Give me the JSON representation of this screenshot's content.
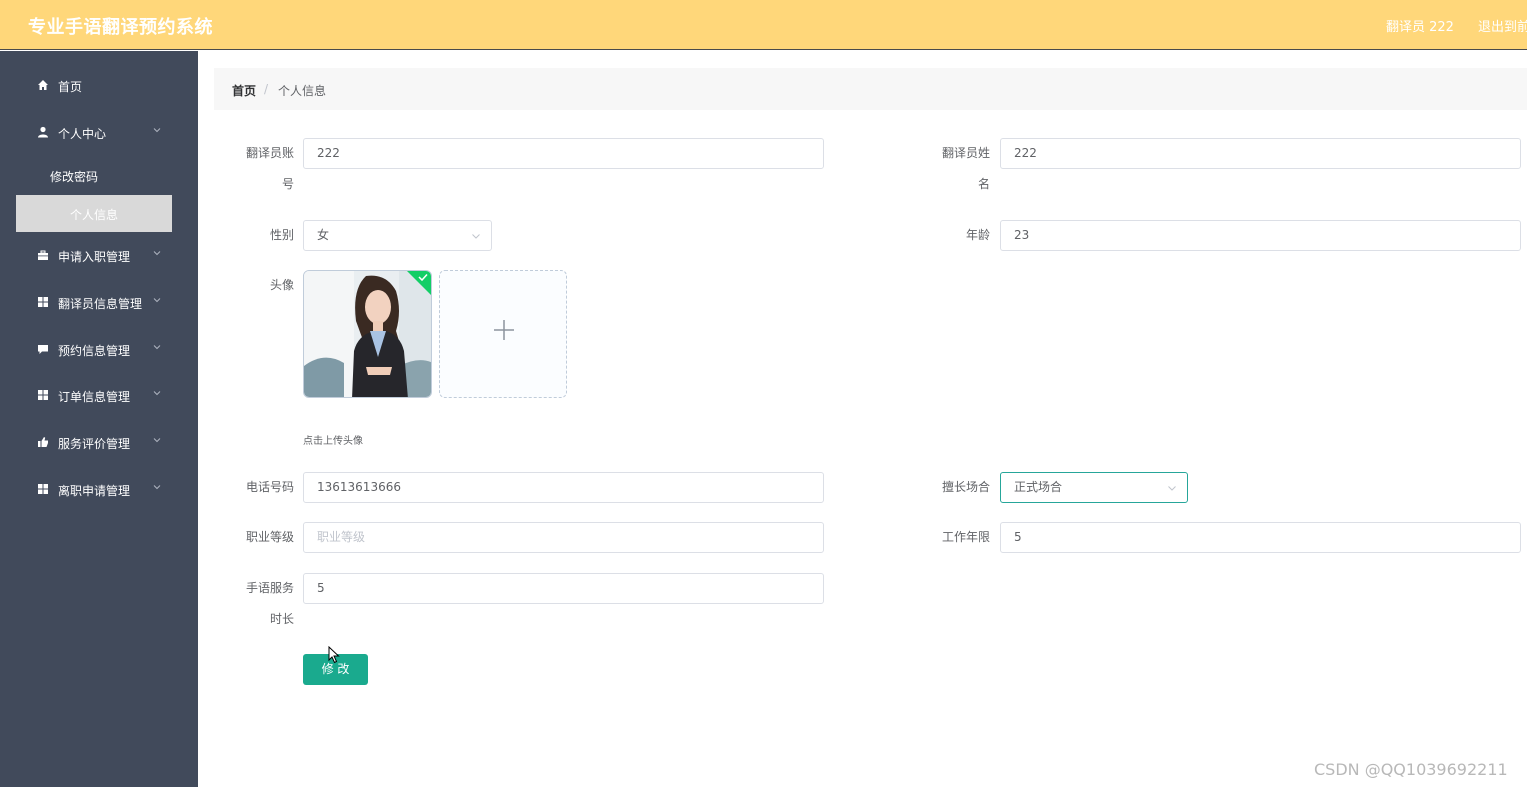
{
  "header": {
    "title": "专业手语翻译预约系统",
    "user_label": "翻译员 222",
    "logout_label": "退出到前台"
  },
  "sidebar": {
    "items": [
      {
        "label": "首页",
        "icon": "home-icon",
        "expandable": false
      },
      {
        "label": "个人中心",
        "icon": "user-icon",
        "expandable": true
      },
      {
        "label": "修改密码"
      },
      {
        "label": "个人信息",
        "active": true
      },
      {
        "label": "申请入职管理",
        "icon": "briefcase-icon",
        "expandable": true
      },
      {
        "label": "翻译员信息管理",
        "icon": "grid-icon",
        "expandable": true
      },
      {
        "label": "预约信息管理",
        "icon": "chat-icon",
        "expandable": true
      },
      {
        "label": "订单信息管理",
        "icon": "grid-icon",
        "expandable": true
      },
      {
        "label": "服务评价管理",
        "icon": "thumb-icon",
        "expandable": true
      },
      {
        "label": "离职申请管理",
        "icon": "grid-icon",
        "expandable": true
      }
    ]
  },
  "breadcrumb": {
    "home": "首页",
    "separator": "/",
    "current": "个人信息"
  },
  "form": {
    "account": {
      "label_line1": "翻译员账",
      "label_line2": "号",
      "value": "222"
    },
    "name": {
      "label_line1": "翻译员姓",
      "label_line2": "名",
      "value": "222"
    },
    "gender": {
      "label": "性别",
      "value": "女"
    },
    "age": {
      "label": "年龄",
      "value": "23"
    },
    "avatar": {
      "label": "头像",
      "upload_hint": "点击上传头像"
    },
    "phone": {
      "label": "电话号码",
      "value": "13613613666"
    },
    "specialty": {
      "label": "擅长场合",
      "value": "正式场合"
    },
    "level": {
      "label": "职业等级",
      "placeholder": "职业等级"
    },
    "years": {
      "label": "工作年限",
      "value": "5"
    },
    "hours": {
      "label_line1": "手语服务",
      "label_line2": "时长",
      "value": "5"
    },
    "submit_label": "修 改"
  },
  "watermark": "CSDN @QQ1039692211",
  "colors": {
    "header_bg": "#ffd77a",
    "sidebar_bg": "#414a5b",
    "accent": "#1aaa8e"
  }
}
